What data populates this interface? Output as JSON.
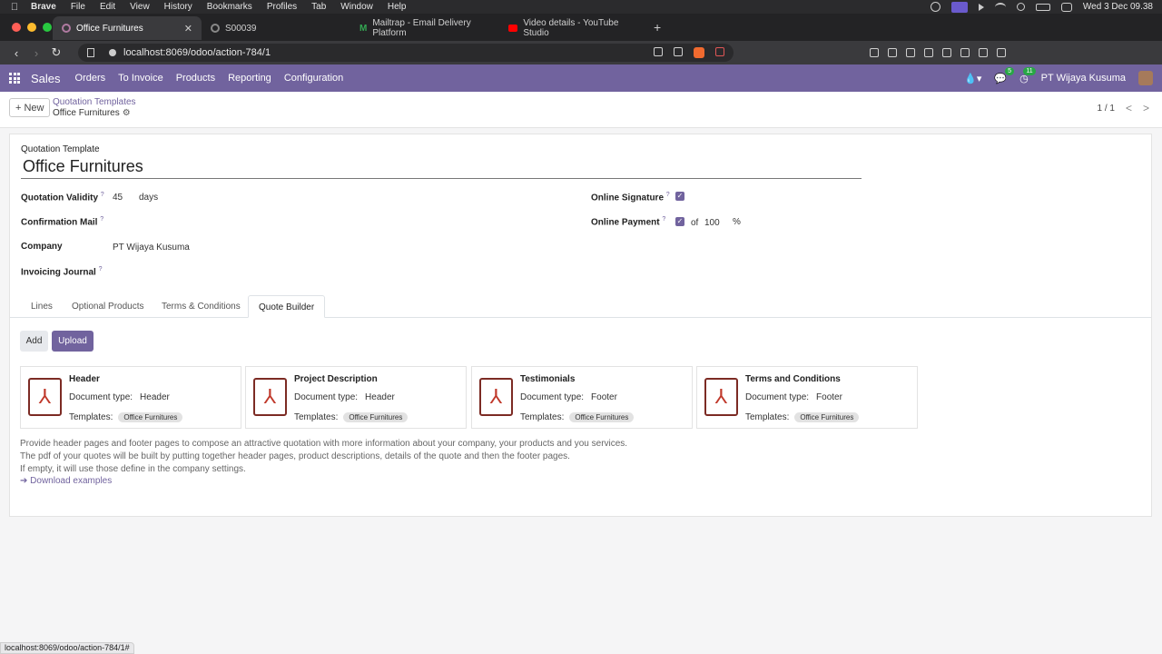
{
  "menubar": {
    "app": "Brave",
    "items": [
      "File",
      "Edit",
      "View",
      "History",
      "Bookmarks",
      "Profiles",
      "Tab",
      "Window",
      "Help"
    ],
    "clock": "Wed 3 Dec 09.38"
  },
  "browser": {
    "tabs": [
      {
        "title": "Office Furnitures",
        "active": true
      },
      {
        "title": "S00039",
        "active": false
      },
      {
        "title": "Mailtrap - Email Delivery Platform",
        "active": false
      },
      {
        "title": "Video details - YouTube Studio",
        "active": false
      }
    ],
    "url": "localhost:8069/odoo/action-784/1",
    "status_url": "localhost:8069/odoo/action-784/1#"
  },
  "odoo_nav": {
    "brand": "Sales",
    "menus": [
      "Orders",
      "To Invoice",
      "Products",
      "Reporting",
      "Configuration"
    ],
    "messages_count": "5",
    "activities_count": "11",
    "company": "PT Wijaya Kusuma"
  },
  "control_panel": {
    "new_label": "New",
    "breadcrumb_parent": "Quotation Templates",
    "breadcrumb_current": "Office Furnitures",
    "pager": "1 / 1"
  },
  "form": {
    "header_label": "Quotation Template",
    "name": "Office Furnitures",
    "validity_label": "Quotation Validity",
    "validity_value": "45",
    "validity_unit": "days",
    "confirmation_mail_label": "Confirmation Mail",
    "company_label": "Company",
    "company_value": "PT Wijaya Kusuma",
    "invoicing_journal_label": "Invoicing Journal",
    "online_signature_label": "Online Signature",
    "online_payment_label": "Online Payment",
    "online_payment_of": "of",
    "online_payment_value": "100",
    "online_payment_unit": "%",
    "help_marker": "?"
  },
  "tabs": [
    "Lines",
    "Optional Products",
    "Terms & Conditions",
    "Quote Builder"
  ],
  "quote_builder": {
    "add_label": "Add",
    "upload_label": "Upload",
    "doc_type_label": "Document type:",
    "templates_label": "Templates:",
    "cards": [
      {
        "title": "Header",
        "doc_type": "Header",
        "template": "Office Furnitures"
      },
      {
        "title": "Project Description",
        "doc_type": "Header",
        "template": "Office Furnitures"
      },
      {
        "title": "Testimonials",
        "doc_type": "Footer",
        "template": "Office Furnitures"
      },
      {
        "title": "Terms and Conditions",
        "doc_type": "Footer",
        "template": "Office Furnitures"
      }
    ],
    "help_lines": [
      "Provide header pages and footer pages to compose an attractive quotation with more information about your company, your products and you services.",
      "The pdf of your quotes will be built by putting together header pages, product descriptions, details of the quote and then the footer pages.",
      "If empty, it will use those define in the company settings."
    ],
    "download_label": "Download examples"
  },
  "colors": {
    "brand": "#71639e",
    "pdf_frame": "#7c2b24"
  }
}
